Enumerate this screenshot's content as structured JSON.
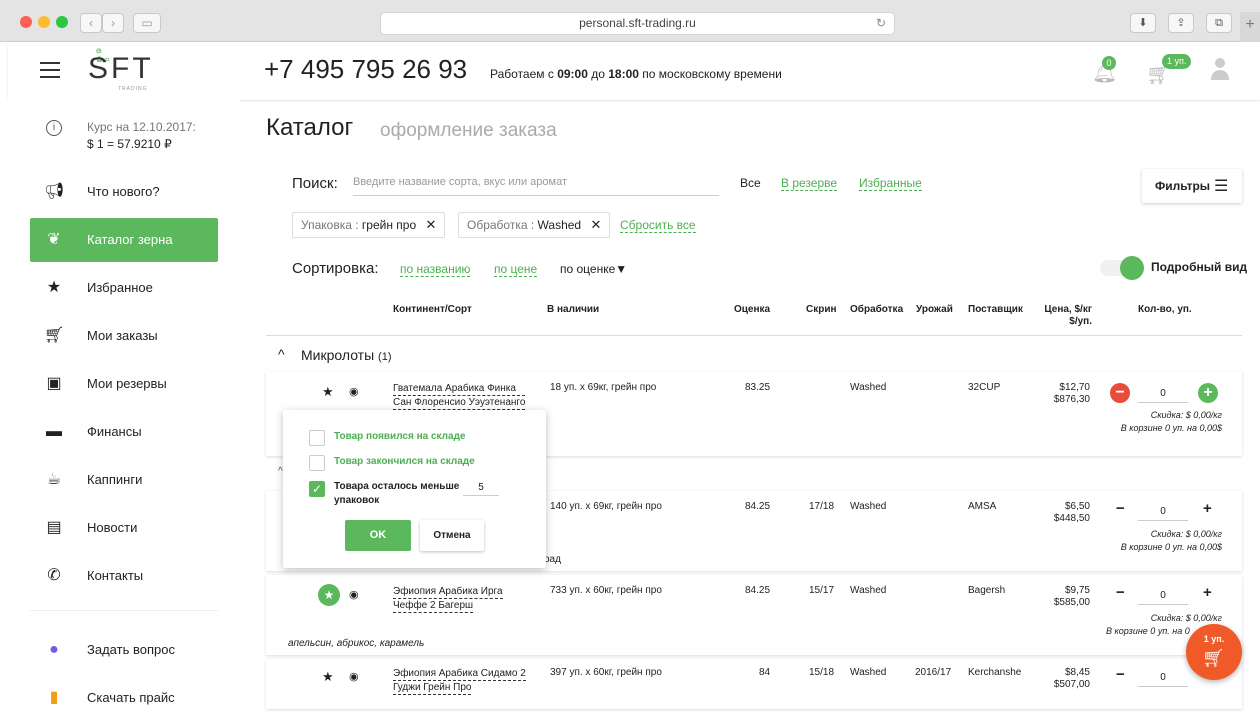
{
  "browser": {
    "url": "personal.sft-trading.ru",
    "colors": {
      "close": "#fd5f57",
      "min": "#fdbc2e",
      "max": "#28c840"
    }
  },
  "header": {
    "logo_text": "SFT",
    "logo_sub": "TRADING",
    "phone": "+7 495 795 26 93",
    "hours_prefix": "Работаем с ",
    "hours_from": "09:00",
    "hours_mid": " до ",
    "hours_to": "18:00",
    "hours_suffix": " по московскому времени",
    "notif_count": "0",
    "cart_badge": "1 уп."
  },
  "sidebar": {
    "rate_label": "Курс на 12.10.2017:",
    "rate_value": "$ 1 = 57.9210 ₽",
    "items": [
      {
        "label": "Что нового?",
        "icon": "megaphone-icon"
      },
      {
        "label": "Каталог зерна",
        "icon": "coffee-bean-icon"
      },
      {
        "label": "Избранное",
        "icon": "star-icon"
      },
      {
        "label": "Мои заказы",
        "icon": "cart-icon"
      },
      {
        "label": "Мои резервы",
        "icon": "safe-icon"
      },
      {
        "label": "Финансы",
        "icon": "wallet-icon"
      },
      {
        "label": "Каппинги",
        "icon": "cup-icon"
      },
      {
        "label": "Новости",
        "icon": "news-icon"
      },
      {
        "label": "Контакты",
        "icon": "phone-icon"
      }
    ],
    "ask": "Задать вопрос",
    "download": "Скачать прайс"
  },
  "page": {
    "title": "Каталог",
    "subtitle": "оформление заказа",
    "search_label": "Поиск:",
    "search_placeholder": "Введите название сорта, вкус или аромат",
    "filter_all": "Все",
    "filter_reserve": "В резерве",
    "filter_fav": "Избранные",
    "filters_button": "Фильтры",
    "chip1_key": "Упаковка : ",
    "chip1_val": "грейн про",
    "chip2_key": "Обработка : ",
    "chip2_val": "Washed",
    "reset": "Сбросить все",
    "sort_label": "Сортировка:",
    "sort_name": "по названию",
    "sort_price": "по цене",
    "sort_score": "по оценке",
    "detailed_view": "Подробный вид"
  },
  "table": {
    "headers": {
      "variety": "Континент/Сорт",
      "stock": "В наличии",
      "score": "Оценка",
      "screen": "Скрин",
      "process": "Обработка",
      "harvest": "Урожай",
      "supplier": "Поставщик",
      "price": "Цена, $/кг $/уп.",
      "qty": "Кол-во, уп."
    },
    "group_name": "Микролоты",
    "group_count": "(1)",
    "rows": [
      {
        "name1": "Гватемала Арабика Финка",
        "name2": "Сан Флоренсио Уэуэтенанго",
        "stock": "18 уп. х 69кг, грейн про",
        "score": "83.25",
        "screen": "",
        "process": "Washed",
        "harvest": "",
        "supplier": "32CUP",
        "price1": "$12,70",
        "price2": "$876,30",
        "qty": "0",
        "disc": "Скидка: $ 0,00/кг",
        "cart": "В корзине 0 уп. на 0,00$"
      },
      {
        "name1": "",
        "name2": "",
        "stock": "140 уп. х 69кг, грейн про",
        "score": "84.25",
        "screen": "17/18",
        "process": "Washed",
        "harvest": "",
        "supplier": "AMSA",
        "price1": "$6,50",
        "price2": "$448,50",
        "qty": "0",
        "disc": "Скидка: $ 0,00/кг",
        "cart": "В корзине 0 уп. на 0,00$",
        "notes_tail": "рад"
      },
      {
        "name1": "Эфиопия Арабика Ирга",
        "name2": "Чеффе 2 Багерш",
        "stock": "733 уп. х 60кг, грейн про",
        "score": "84.25",
        "screen": "15/17",
        "process": "Washed",
        "harvest": "",
        "supplier": "Bagersh",
        "price1": "$9,75",
        "price2": "$585,00",
        "qty": "0",
        "disc": "Скидка: $ 0,00/кг",
        "cart": "В корзине 0 уп. на 0",
        "notes": "апельсин, абрикос, карамель"
      },
      {
        "name1": "Эфиопия Арабика Сидамо 2",
        "name2": "Гуджи Грейн Про",
        "stock": "397 уп. х 60кг, грейн про",
        "score": "84",
        "screen": "15/18",
        "process": "Washed",
        "harvest": "2016/17",
        "supplier": "Kerchanshe",
        "price1": "$8,45",
        "price2": "$507,00",
        "qty": "0"
      }
    ]
  },
  "popup": {
    "opt1": "Товар появился на складе",
    "opt2": "Товар закончился на складе",
    "opt3_a": "Товара осталось меньше",
    "opt3_b": "упаковок",
    "threshold": "5",
    "ok": "OK",
    "cancel": "Отмена"
  },
  "fab_cart": "1 уп.",
  "colors": {
    "accent": "#4caf50",
    "danger": "#e74c3c",
    "fab": "#f05a28"
  }
}
